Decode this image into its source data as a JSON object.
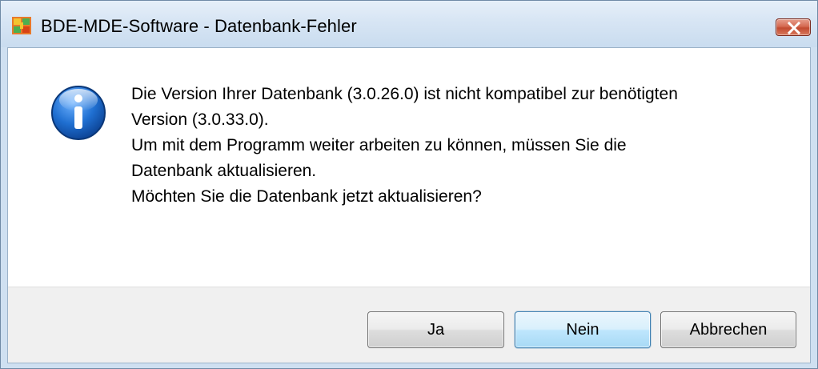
{
  "window": {
    "title": "BDE-MDE-Software - Datenbank-Fehler"
  },
  "dialog": {
    "icon": "info-icon",
    "message_lines": [
      "Die Version Ihrer Datenbank (3.0.26.0) ist nicht kompatibel zur benötigten",
      "Version (3.0.33.0).",
      "Um mit dem Programm weiter arbeiten zu können, müssen Sie die",
      "Datenbank aktualisieren.",
      "Möchten Sie die Datenbank jetzt aktualisieren?"
    ]
  },
  "buttons": {
    "yes": "Ja",
    "no": "Nein",
    "cancel": "Abbrechen",
    "default": "no"
  },
  "colors": {
    "accent": "#3c7fb1",
    "close_button": "#c24a30",
    "titlebar": "#d7e5f4"
  }
}
